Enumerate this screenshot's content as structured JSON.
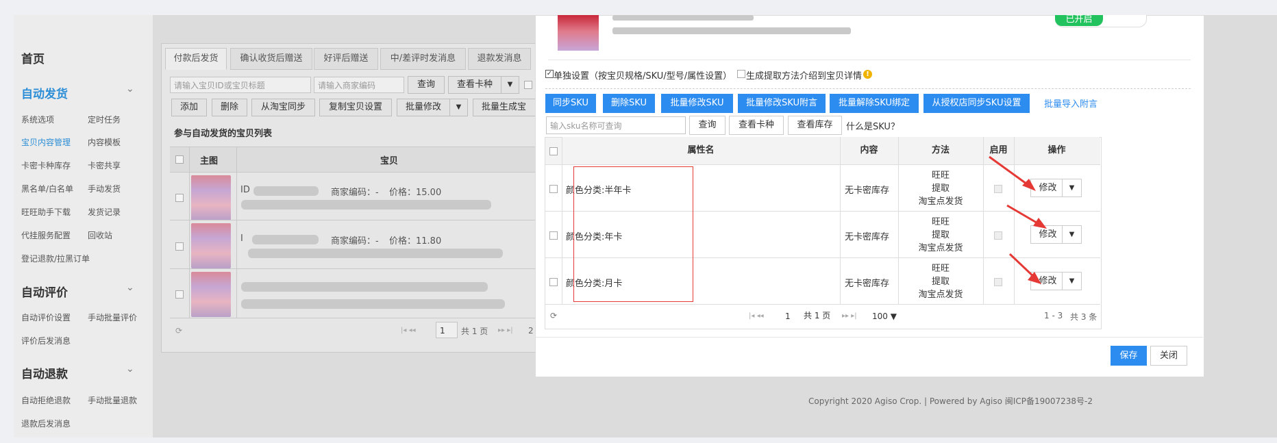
{
  "sidebar": {
    "home": "首页",
    "sections": [
      {
        "title": "自动发货",
        "items": [
          "系统选项",
          "定时任务",
          "宝贝内容管理",
          "内容模板",
          "卡密卡种库存",
          "卡密共享",
          "黑名单/白名单",
          "手动发货",
          "旺旺助手下载",
          "发货记录",
          "代挂服务配置",
          "回收站",
          "登记退款/拉黑订单"
        ]
      },
      {
        "title": "自动评价",
        "items": [
          "自动评价设置",
          "手动批量评价",
          "评价后发消息"
        ]
      },
      {
        "title": "自动退款",
        "items": [
          "自动拒绝退款",
          "手动批量退款",
          "退款后发消息"
        ]
      }
    ]
  },
  "bg": {
    "tabs": [
      "付款后发货",
      "确认收货后赠送",
      "好评后赠送",
      "中/差评时发消息",
      "退款发消息"
    ],
    "search_placeholder": "请输入宝贝ID或宝贝标题",
    "code_placeholder": "请输入商家编码",
    "query": "查询",
    "view_cards": "查看卡种",
    "actions": [
      "添加",
      "删除",
      "从淘宝同步",
      "复制宝贝设置",
      "批量修改",
      "批量生成宝"
    ],
    "list_title": "参与自动发货的宝贝列表",
    "col_main": "主图",
    "col_item": "宝贝",
    "rows": [
      {
        "id": "ID",
        "code": "商家编码：-",
        "price": "价格：15.00"
      },
      {
        "id": "I",
        "code": "商家编码：-",
        "price": "价格：11.80"
      }
    ],
    "page_num": "1",
    "page_total": "共 1 页",
    "page_suffix": "2"
  },
  "modal": {
    "status": "已开启",
    "opt_individual": "单独设置（按宝贝规格/SKU/型号/属性设置）",
    "opt_extract": "生成提取方法介绍到宝贝详情",
    "toolbar": [
      "同步SKU",
      "删除SKU",
      "批量修改SKU",
      "批量修改SKU附言",
      "批量解除SKU绑定",
      "从授权店同步SKU设置"
    ],
    "import_link": "批量导入附言",
    "sku_placeholder": "输入sku名称可查询",
    "query": "查询",
    "view_cards": "查看卡种",
    "view_stock": "查看库存",
    "what_sku": "什么是SKU？",
    "headers": [
      "属性名",
      "内容",
      "方法",
      "启用",
      "操作"
    ],
    "rows": [
      {
        "attr": "颜色分类:半年卡",
        "content": "无卡密库存",
        "method": [
          "旺旺",
          "提取",
          "淘宝点发货"
        ],
        "op": "修改"
      },
      {
        "attr": "颜色分类:年卡",
        "content": "无卡密库存",
        "method": [
          "旺旺",
          "提取",
          "淘宝点发货"
        ],
        "op": "修改"
      },
      {
        "attr": "颜色分类:月卡",
        "content": "无卡密库存",
        "method": [
          "旺旺",
          "提取",
          "淘宝点发货"
        ],
        "op": "修改"
      }
    ],
    "pager": {
      "page": "1",
      "total": "共 1 页",
      "size": "100 ▼",
      "range": "1 - 3",
      "count": "共 3 条"
    },
    "save": "保存",
    "close": "关闭"
  },
  "footer": "Copyright 2020 Agiso Crop. | Powered by Agiso 闽ICP备19007238号-2",
  "colors": {
    "accent": "#2d8cf0",
    "arrow": "#e53935",
    "status": "#22c35e"
  }
}
